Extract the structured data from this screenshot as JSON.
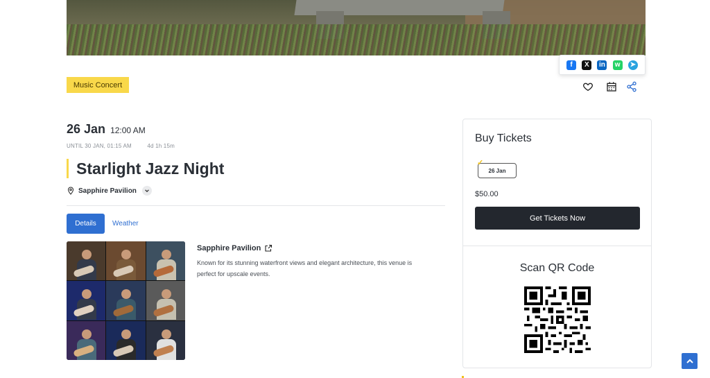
{
  "event": {
    "category": "Music Concert",
    "date_day": "26 Jan",
    "date_time": "12:00 AM",
    "until": "UNTIL 30 JAN, 01:15 AM",
    "remaining": "4d 1h 15m",
    "title": "Starlight Jazz Night",
    "venue": "Sapphire Pavilion"
  },
  "share": {
    "facebook_icon": "facebook-icon",
    "x_icon": "x-icon",
    "linkedin_icon": "linkedin-icon",
    "whatsapp_icon": "whatsapp-icon",
    "telegram_icon": "telegram-icon"
  },
  "tabs": [
    {
      "label": "Details",
      "active": true
    },
    {
      "label": "Weather",
      "active": false
    }
  ],
  "venue_details": {
    "name": "Sapphire Pavilion",
    "description": "Known for its stunning waterfront views and elegant architecture, this venue is perfect for upscale events."
  },
  "tickets": {
    "heading": "Buy Tickets",
    "date_chip": "26 Jan",
    "price": "$50.00",
    "button": "Get Tickets Now",
    "qr_heading": "Scan QR Code"
  },
  "colors": {
    "accent": "#2f6fd1",
    "tag_bg": "#f9d84a",
    "dark_button": "#23272e"
  }
}
